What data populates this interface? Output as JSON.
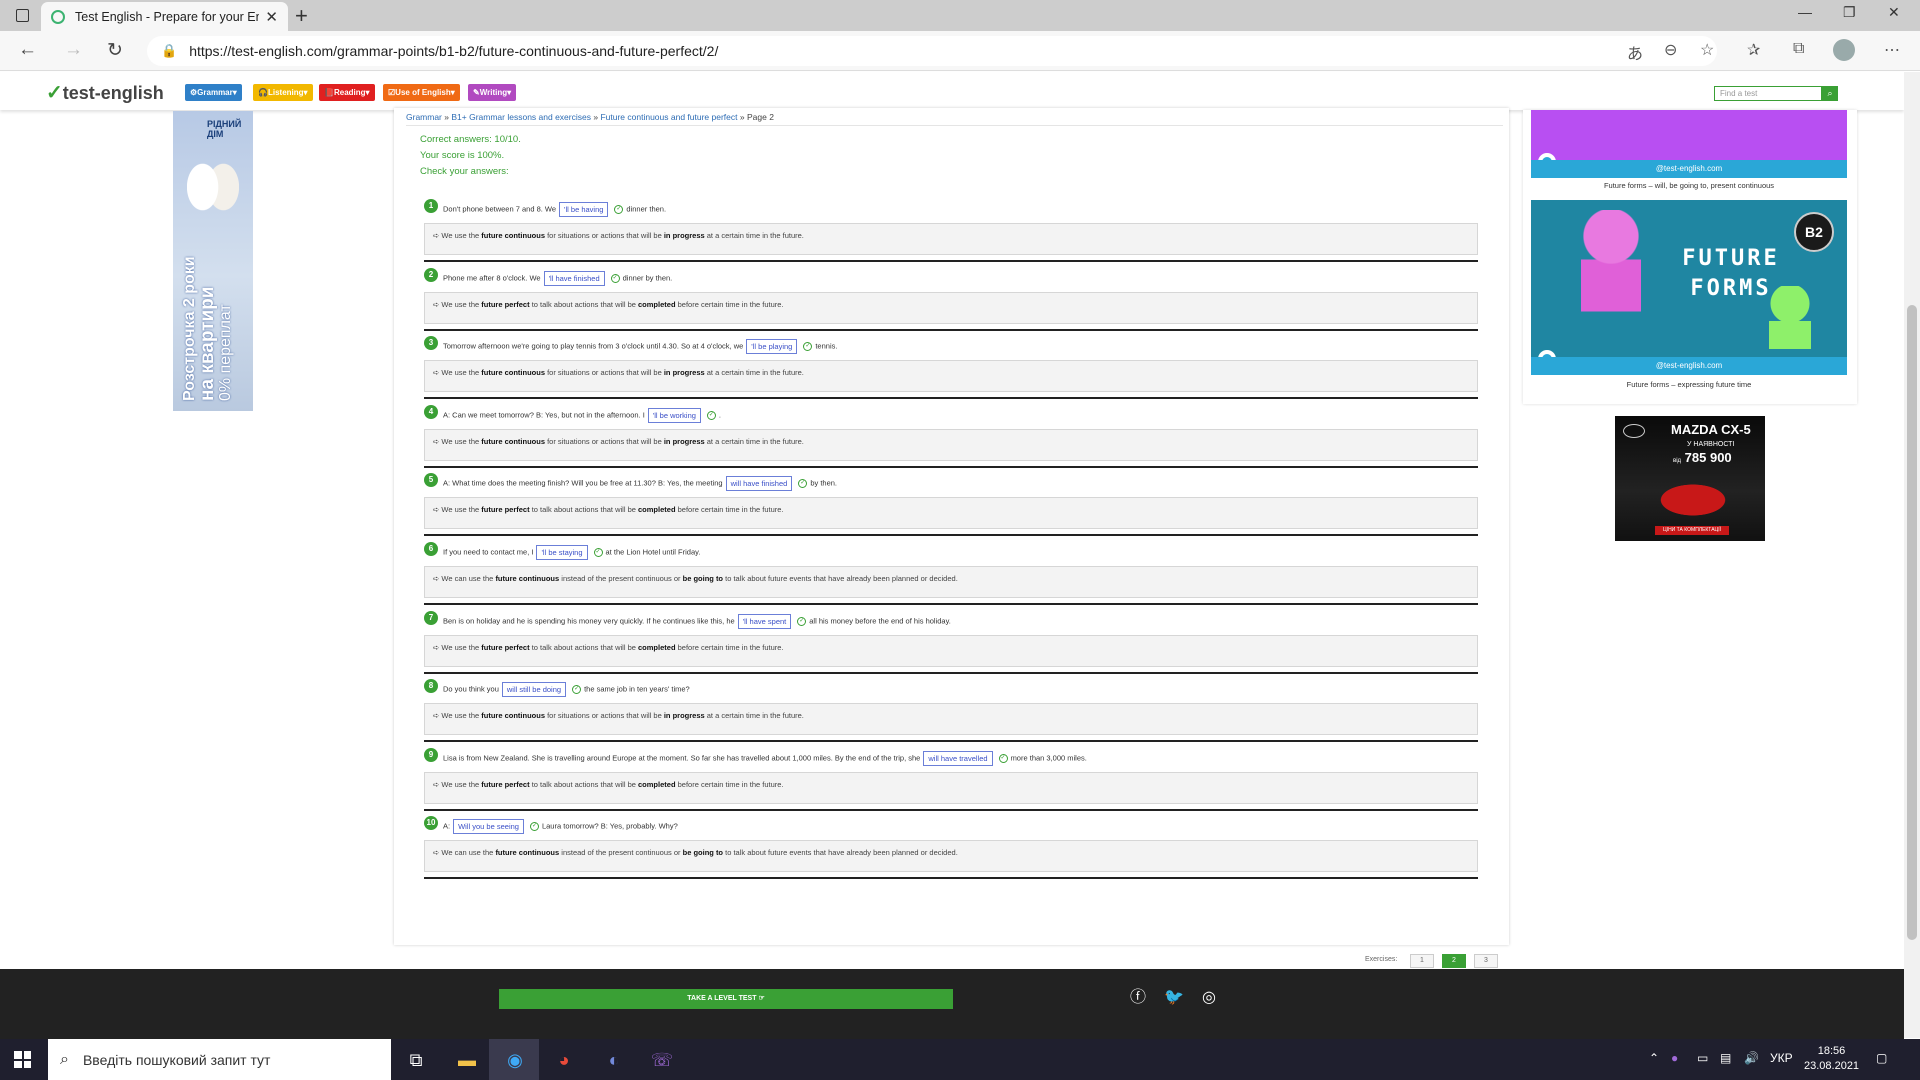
{
  "browser": {
    "tab_title": "Test English - Prepare for your En",
    "url": "https://test-english.com/grammar-points/b1-b2/future-continuous-and-future-perfect/2/"
  },
  "site": {
    "logo": "test-english",
    "menu": [
      {
        "label": "Grammar",
        "color": "#2f80c8"
      },
      {
        "label": "Listening",
        "color": "#f2b800"
      },
      {
        "label": "Reading",
        "color": "#e02020"
      },
      {
        "label": "Use of English",
        "color": "#f06a14"
      },
      {
        "label": "Writing",
        "color": "#b14ac0"
      }
    ],
    "search_placeholder": "Find a test"
  },
  "ad_left": {
    "brand": "РІДНИЙ ДІМ",
    "text_line1": "Розстрочка 2 роки",
    "text_line2": "на квартири",
    "text_line3": "0% переплат"
  },
  "breadcrumb": {
    "items": [
      "Grammar",
      "B1+ Grammar lessons and exercises",
      "Future continuous and future perfect"
    ],
    "sep": "»",
    "current": "Page 2"
  },
  "results": {
    "correct": "Correct answers: 10/10.",
    "score": "Your score is 100%.",
    "check": "Check your answers:"
  },
  "questions": [
    {
      "num": "1",
      "before": "Don't phone between 7 and 8. We",
      "answer": "'ll be having",
      "after": "dinner then.",
      "e1": "We use the ",
      "b1": "future continuous",
      "e2": " for situations or actions that will be ",
      "b2": "in progress",
      "e3": " at a certain time in the future."
    },
    {
      "num": "2",
      "before": "Phone me after 8 o'clock. We",
      "answer": "'ll have finished",
      "after": "dinner by then.",
      "e1": "We use the ",
      "b1": "future perfect",
      "e2": " to talk about actions that will be ",
      "b2": "completed",
      "e3": " before certain time in the future."
    },
    {
      "num": "3",
      "before": "Tomorrow afternoon we're going to play tennis from 3 o'clock until 4.30. So at 4 o'clock, we",
      "answer": "'ll be playing",
      "after": "tennis.",
      "e1": "We use the ",
      "b1": "future continuous",
      "e2": " for situations or actions that will be ",
      "b2": "in progress",
      "e3": " at a certain time in the future."
    },
    {
      "num": "4",
      "before": "A: Can we meet tomorrow? B: Yes, but not in the afternoon. I",
      "answer": "'ll be working",
      "after": ".",
      "e1": "We use the ",
      "b1": "future continuous",
      "e2": " for situations or actions that will be ",
      "b2": "in progress",
      "e3": " at a certain time in the future."
    },
    {
      "num": "5",
      "before": "A: What time does the meeting finish? Will you be free at 11.30? B: Yes, the meeting",
      "answer": "will have finished",
      "after": "by then.",
      "e1": "We use the ",
      "b1": "future perfect",
      "e2": " to talk about actions that will be ",
      "b2": "completed",
      "e3": " before certain time in the future."
    },
    {
      "num": "6",
      "before": "If you need to contact me, I",
      "answer": "'ll be staying",
      "after": "at the Lion Hotel until Friday.",
      "e1": "We can use the ",
      "b1": "future continuous",
      "e2": " instead of the present continuous or ",
      "b2": "be going to",
      "e3": " to talk about future events that have already been planned or decided."
    },
    {
      "num": "7",
      "before": "Ben is on holiday and he is spending his money very quickly. If he continues like this, he",
      "answer": "'ll have spent",
      "after": "all his money before the end of his holiday.",
      "e1": "We use the ",
      "b1": "future perfect",
      "e2": " to talk about actions that will be ",
      "b2": "completed",
      "e3": " before certain time in the future."
    },
    {
      "num": "8",
      "before": "Do you think you",
      "answer": "will still be doing",
      "after": "the same job in ten years' time?",
      "e1": "We use the ",
      "b1": "future continuous",
      "e2": " for situations or actions that will be ",
      "b2": "in progress",
      "e3": " at a certain time in the future."
    },
    {
      "num": "9",
      "before": "Lisa is from New Zealand. She is travelling around Europe at the moment. So far she has travelled about 1,000 miles. By the end of the trip, she",
      "answer": "will have travelled",
      "after": "more than 3,000 miles.",
      "e1": "We use the ",
      "b1": "future perfect",
      "e2": " to talk about actions that will be ",
      "b2": "completed",
      "e3": " before certain time in the future."
    },
    {
      "num": "10",
      "before": "A:",
      "answer": "Will you be seeing",
      "after": "Laura tomorrow? B: Yes, probably. Why?",
      "e1": "We can use the ",
      "b1": "future continuous",
      "e2": " instead of the present continuous or ",
      "b2": "be going to",
      "e3": " to talk about future events that have already been planned or decided."
    }
  ],
  "pager": {
    "label": "Exercises:",
    "pages": [
      "1",
      "2",
      "3"
    ],
    "current": "2"
  },
  "right": {
    "caption1": "Future forms – will, be going to, present continuous",
    "image_site": "@test-english.com",
    "image2_title_1": "FUTURE",
    "image2_title_2": "FORMS",
    "image2_badge": "B2",
    "caption2": "Future forms – expressing future time"
  },
  "ad_mazda": {
    "model": "MAZDA CX-5",
    "stock": "У НАЯВНОСТІ",
    "price": "785 900",
    "price_prefix": "від",
    "cta": "ЦІНИ ТА КОМПЛЕКТАЦІЇ"
  },
  "footer": {
    "level_test": "TAKE A LEVEL TEST"
  },
  "taskbar": {
    "search_placeholder": "Введіть пошуковий запит тут",
    "lang": "УКР",
    "time": "18:56",
    "date": "23.08.2021"
  }
}
